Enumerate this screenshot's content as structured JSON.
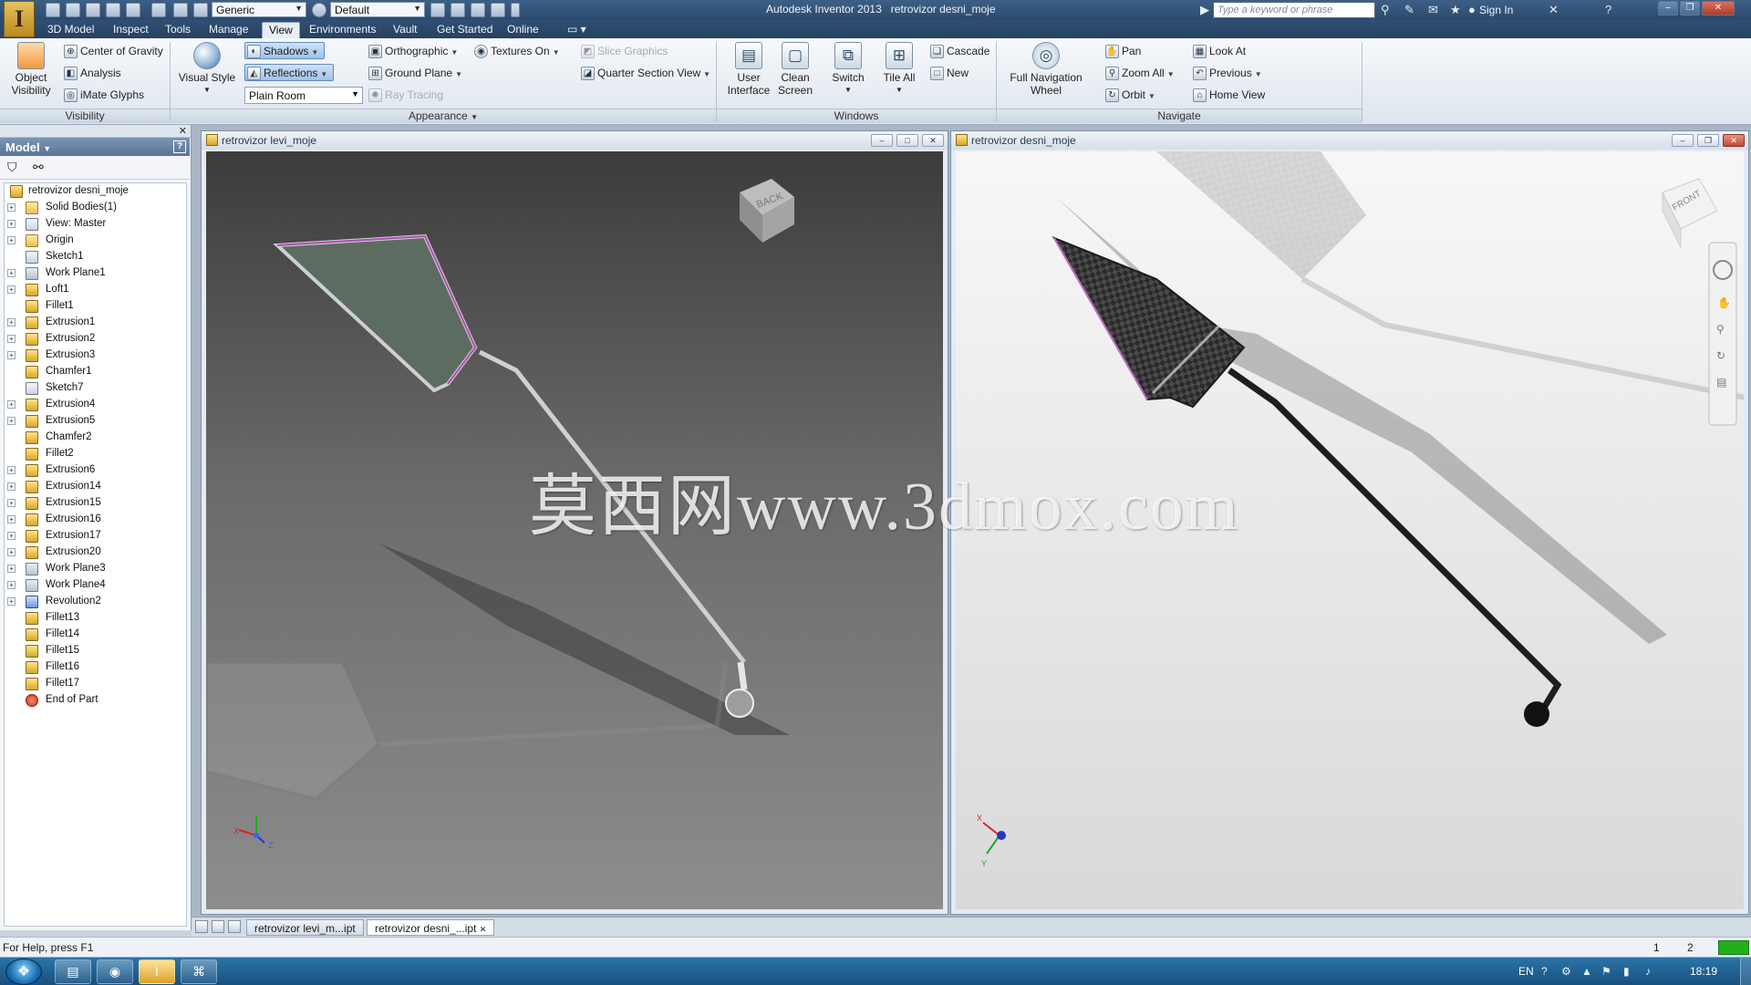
{
  "titlebar": {
    "style_combo": "Generic",
    "appearance_combo": "Default",
    "app_title": "Autodesk Inventor 2013",
    "doc_title": "retrovizor desni_moje",
    "search_placeholder": "Type a keyword or phrase",
    "sign_in": "Sign In"
  },
  "menu": {
    "tabs": [
      "3D Model",
      "Inspect",
      "Tools",
      "Manage",
      "View",
      "Environments",
      "Vault",
      "Get Started",
      "Online"
    ],
    "active": "View"
  },
  "ribbon": {
    "visibility": {
      "object_visibility": "Object\nVisibility",
      "object_visibility_l1": "Object",
      "object_visibility_l2": "Visibility",
      "center_of_gravity": "Center of Gravity",
      "analysis": "Analysis",
      "imate_glyphs": "iMate Glyphs",
      "panel": "Visibility"
    },
    "appearance": {
      "visual_style": "Visual Style",
      "shadows": "Shadows",
      "reflections": "Reflections",
      "lighting_combo": "Plain Room",
      "orthographic": "Orthographic",
      "textures_on": "Textures On",
      "ground_plane": "Ground Plane",
      "ray_tracing": "Ray Tracing",
      "slice_graphics": "Slice Graphics",
      "quarter_section_view": "Quarter Section View",
      "panel": "Appearance"
    },
    "windows": {
      "user_interface_l1": "User",
      "user_interface_l2": "Interface",
      "clean_screen_l1": "Clean",
      "clean_screen_l2": "Screen",
      "switch": "Switch",
      "tile_all": "Tile All",
      "cascade": "Cascade",
      "new": "New",
      "panel": "Windows"
    },
    "navigate": {
      "full_nav_l1": "Full Navigation",
      "full_nav_l2": "Wheel",
      "pan": "Pan",
      "zoom_all": "Zoom All",
      "orbit": "Orbit",
      "look_at": "Look At",
      "previous": "Previous",
      "home_view": "Home View",
      "panel": "Navigate"
    }
  },
  "browser": {
    "header": "Model",
    "items": [
      {
        "label": "retrovizor desni_moje",
        "icon": "part-icon"
      },
      {
        "label": "Solid Bodies(1)",
        "icon": "folder-icon"
      },
      {
        "label": "View: Master",
        "icon": "view-icon"
      },
      {
        "label": "Origin",
        "icon": "folder-icon"
      },
      {
        "label": "Sketch1",
        "icon": "sketch-icon"
      },
      {
        "label": "Work Plane1",
        "icon": "workplane-icon"
      },
      {
        "label": "Loft1",
        "icon": "feature-icon"
      },
      {
        "label": "Fillet1",
        "icon": "feature-icon"
      },
      {
        "label": "Extrusion1",
        "icon": "feature-icon"
      },
      {
        "label": "Extrusion2",
        "icon": "feature-icon"
      },
      {
        "label": "Extrusion3",
        "icon": "feature-icon"
      },
      {
        "label": "Chamfer1",
        "icon": "feature-icon"
      },
      {
        "label": "Sketch7",
        "icon": "sketch-icon"
      },
      {
        "label": "Extrusion4",
        "icon": "feature-icon"
      },
      {
        "label": "Extrusion5",
        "icon": "feature-icon"
      },
      {
        "label": "Chamfer2",
        "icon": "feature-icon"
      },
      {
        "label": "Fillet2",
        "icon": "feature-icon"
      },
      {
        "label": "Extrusion6",
        "icon": "feature-icon"
      },
      {
        "label": "Extrusion14",
        "icon": "feature-icon"
      },
      {
        "label": "Extrusion15",
        "icon": "feature-icon"
      },
      {
        "label": "Extrusion16",
        "icon": "feature-icon"
      },
      {
        "label": "Extrusion17",
        "icon": "feature-icon"
      },
      {
        "label": "Extrusion20",
        "icon": "feature-icon"
      },
      {
        "label": "Work Plane3",
        "icon": "workplane-icon"
      },
      {
        "label": "Work Plane4",
        "icon": "workplane-icon"
      },
      {
        "label": "Revolution2",
        "icon": "revolve-icon"
      },
      {
        "label": "Fillet13",
        "icon": "feature-icon"
      },
      {
        "label": "Fillet14",
        "icon": "feature-icon"
      },
      {
        "label": "Fillet15",
        "icon": "feature-icon"
      },
      {
        "label": "Fillet16",
        "icon": "feature-icon"
      },
      {
        "label": "Fillet17",
        "icon": "feature-icon"
      },
      {
        "label": "End of Part",
        "icon": "end-of-part-icon"
      }
    ]
  },
  "documents": {
    "left": {
      "title": "retrovizor levi_moje",
      "viewcube": "BACK"
    },
    "right": {
      "title": "retrovizor desni_moje",
      "viewcube": "FRONT"
    }
  },
  "axes": {
    "x": "X",
    "y": "Y",
    "z": "Z"
  },
  "doc_tabs": [
    "retrovizor levi_m...ipt",
    "retrovizor desni_...ipt"
  ],
  "watermark": "莫西网www.3dmox.com",
  "status": {
    "help": "For Help, press F1",
    "n1": "1",
    "n2": "2"
  },
  "taskbar": {
    "lang": "EN",
    "clock": "18:19"
  }
}
